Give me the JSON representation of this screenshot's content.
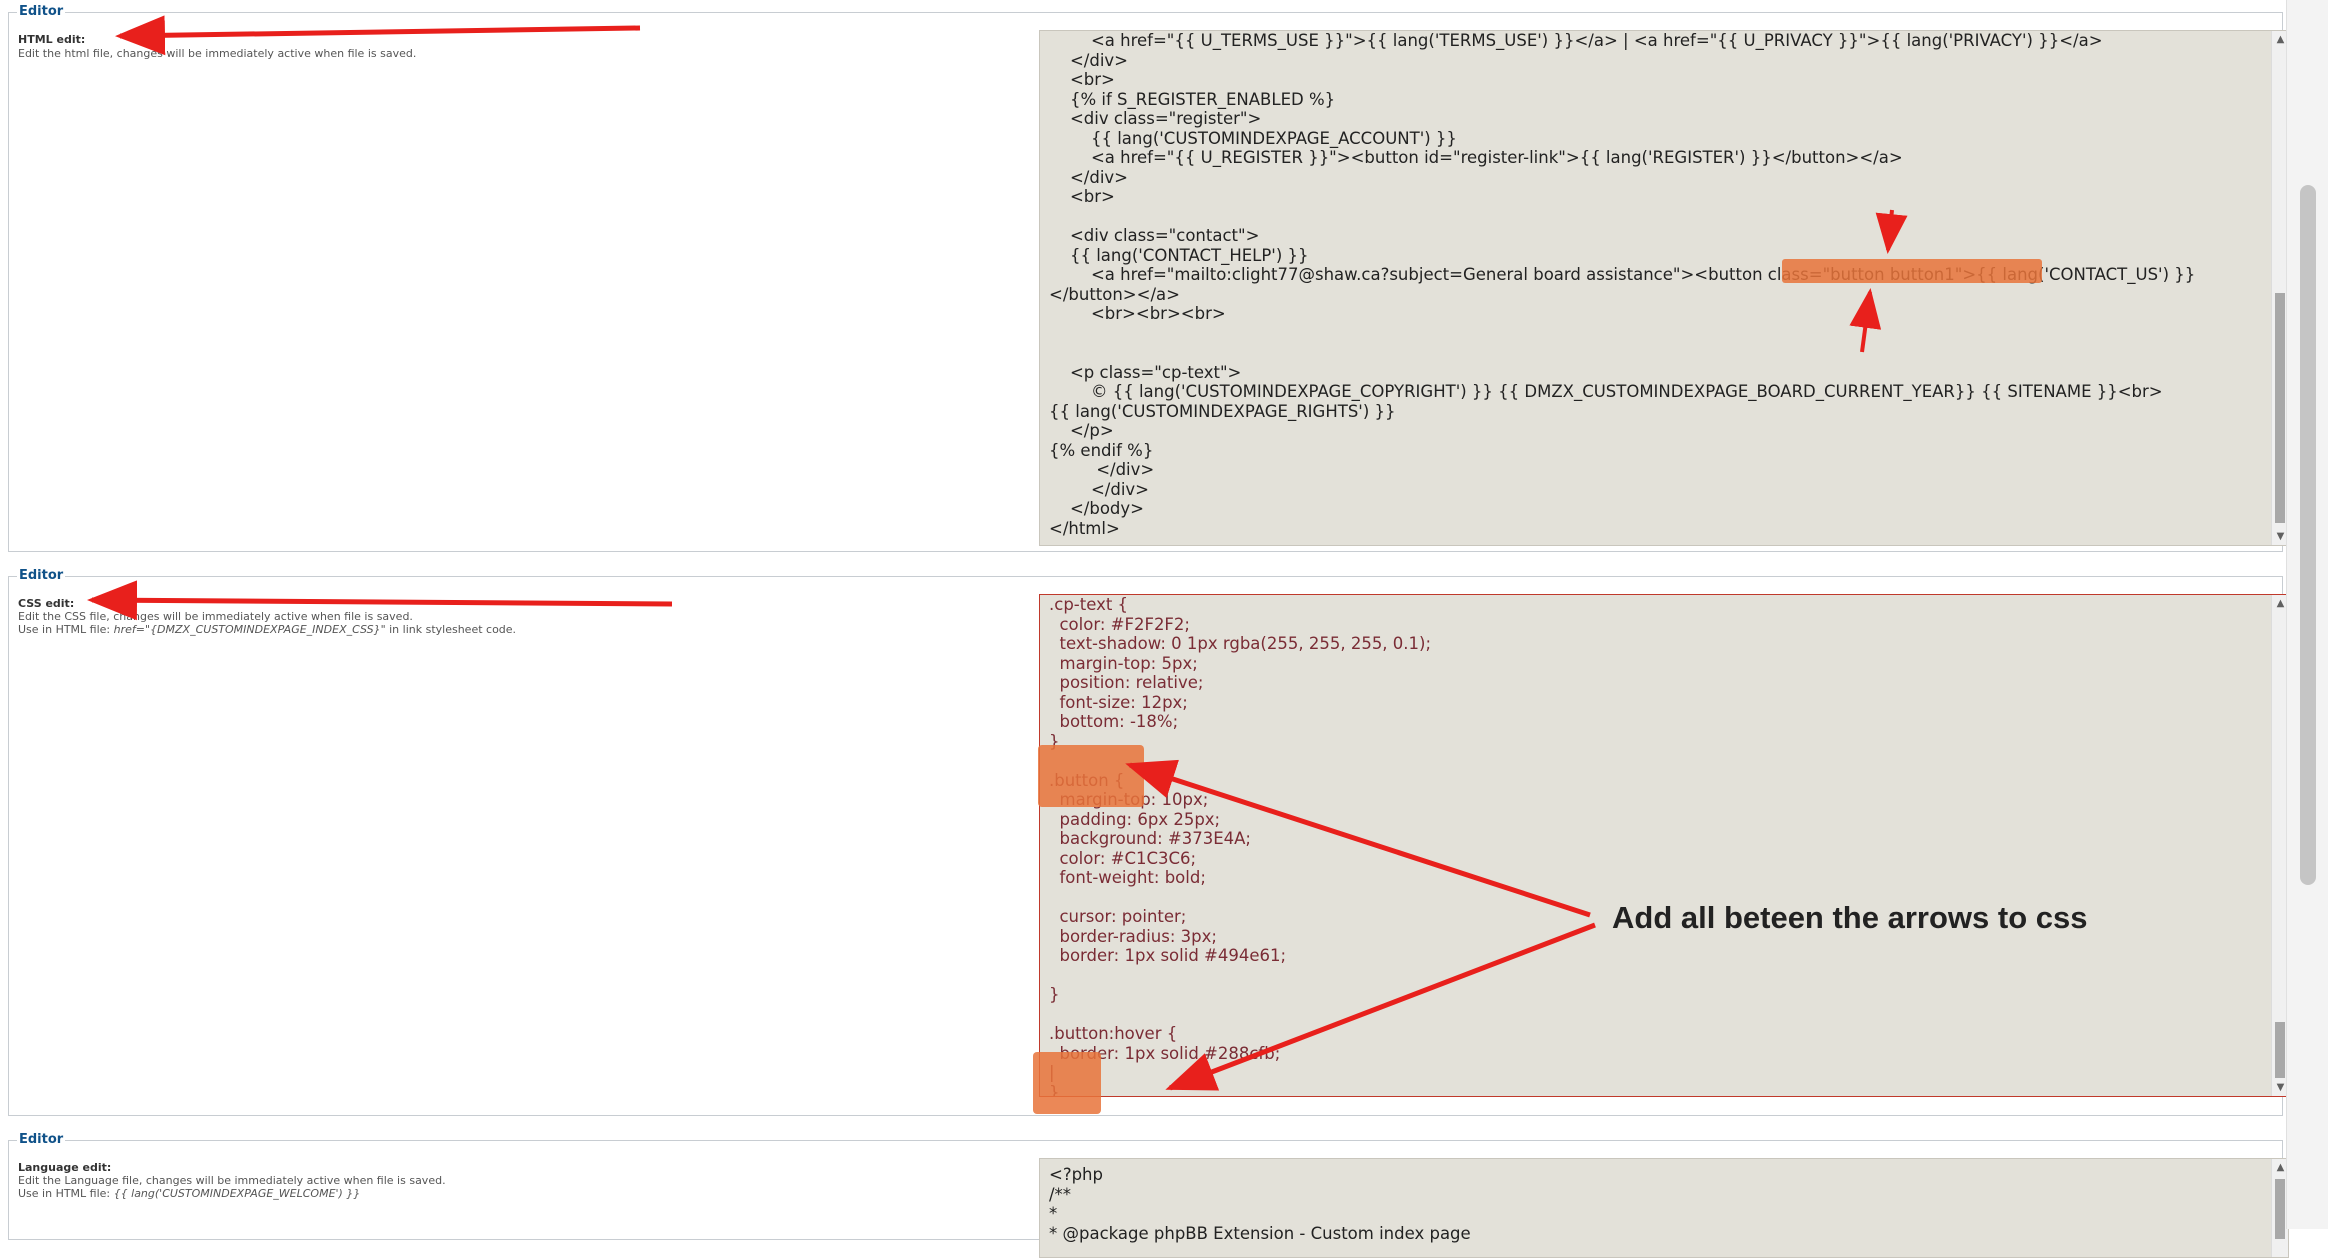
{
  "html_editor": {
    "legend": "Editor",
    "title": "HTML edit:",
    "description": "Edit the html file, changes will be immediately active when file is saved.",
    "code_lines": [
      "        <a href=\"{{ U_TERMS_USE }}\">{{ lang('TERMS_USE') }}</a> | <a href=\"{{ U_PRIVACY }}\">{{ lang('PRIVACY') }}</a>",
      "    </div>",
      "    <br>",
      "    {% if S_REGISTER_ENABLED %}",
      "    <div class=\"register\">",
      "        {{ lang('CUSTOMINDEXPAGE_ACCOUNT') }}",
      "        <a href=\"{{ U_REGISTER }}\"><button id=\"register-link\">{{ lang('REGISTER') }}</button></a>",
      "    </div>",
      "    <br>",
      "",
      "    <div class=\"contact\">",
      "    {{ lang('CONTACT_HELP') }}",
      "        <a href=\"mailto:clight77@shaw.ca?subject=General board assistance\"><button class=\"button button1\">{{ lang('CONTACT_US') }}",
      "</button></a>",
      "        <br><br><br>",
      "",
      "",
      "    <p class=\"cp-text\">",
      "        © {{ lang('CUSTOMINDEXPAGE_COPYRIGHT') }} {{ DMZX_CUSTOMINDEXPAGE_BOARD_CURRENT_YEAR}} {{ SITENAME }}<br>",
      "{{ lang('CUSTOMINDEXPAGE_RIGHTS') }}",
      "    </p>",
      "{% endif %}",
      "         </div>",
      "        </div>",
      "    </body>",
      "</html>"
    ]
  },
  "css_editor": {
    "legend": "Editor",
    "title": "CSS edit:",
    "description": "Edit the CSS file, changes will be immediately active when file is saved.",
    "usage_prefix": "Use in HTML file: ",
    "usage_code": "href=\"{DMZX_CUSTOMINDEXPAGE_INDEX_CSS}\"",
    "usage_suffix": " in link stylesheet code.",
    "code_lines": [
      ".cp-text {",
      "  color: #F2F2F2;",
      "  text-shadow: 0 1px rgba(255, 255, 255, 0.1);",
      "  margin-top: 5px;",
      "  position: relative;",
      "  font-size: 12px;",
      "  bottom: -18%;",
      "}",
      "",
      ".button {",
      "  margin-top: 10px;",
      "  padding: 6px 25px;",
      "  background: #373E4A;",
      "  color: #C1C3C6;",
      "  font-weight: bold;",
      "",
      "  cursor: pointer;",
      "  border-radius: 3px;",
      "  border: 1px solid #494e61;",
      "",
      "}",
      "",
      ".button:hover {",
      "  border: 1px solid #288cfb;",
      "|",
      "}"
    ]
  },
  "language_editor": {
    "legend": "Editor",
    "title": "Language edit:",
    "description": "Edit the Language file, changes will be immediately active when file is saved.",
    "usage_prefix": "Use in HTML file: ",
    "usage_code": "{{ lang('CUSTOMINDEXPAGE_WELCOME') }}",
    "code_lines": [
      "<?php",
      "/**",
      "*",
      "* @package phpBB Extension - Custom index page"
    ]
  },
  "annotation": {
    "text": "Add all beteen the arrows to css"
  },
  "colors": {
    "highlight": "#e8733a",
    "arrow": "#e8201c",
    "css_text": "#7a2c35",
    "legend": "#105289"
  }
}
